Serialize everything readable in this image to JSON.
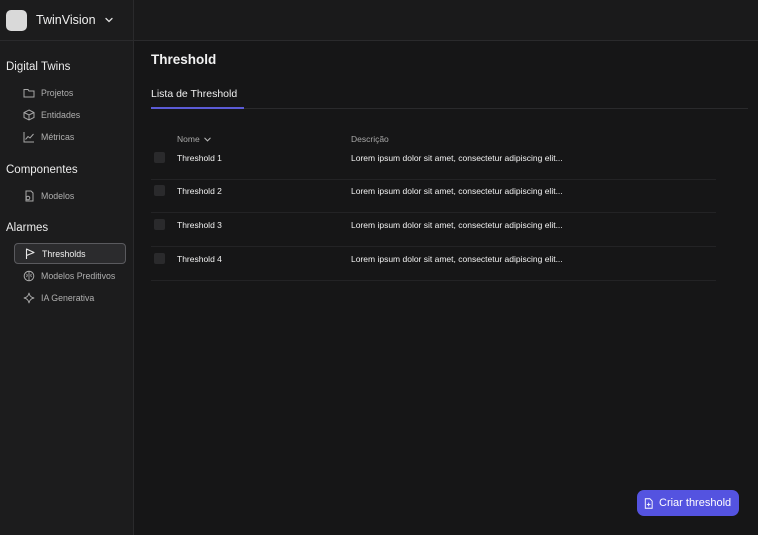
{
  "brand": {
    "name": "TwinVision"
  },
  "sidebar": {
    "sections": [
      {
        "title": "Digital Twins",
        "items": [
          {
            "label": "Projetos",
            "icon": "folder-icon"
          },
          {
            "label": "Entidades",
            "icon": "cube-icon"
          },
          {
            "label": "Métricas",
            "icon": "chart-line-icon"
          }
        ]
      },
      {
        "title": "Componentes",
        "items": [
          {
            "label": "Modelos",
            "icon": "file-model-icon"
          }
        ]
      },
      {
        "title": "Alarmes",
        "items": [
          {
            "label": "Thresholds",
            "icon": "flag-icon",
            "active": true
          },
          {
            "label": "Modelos Preditivos",
            "icon": "brain-icon"
          },
          {
            "label": "IA Generativa",
            "icon": "sparkle-icon"
          }
        ]
      }
    ]
  },
  "main": {
    "title": "Threshold",
    "tab": "Lista de Threshold",
    "table": {
      "columns": [
        "Nome",
        "Descrição"
      ],
      "rows": [
        {
          "name": "Threshold 1",
          "description": "Lorem ipsum dolor sit amet, consectetur adipiscing elit..."
        },
        {
          "name": "Threshold 2",
          "description": "Lorem ipsum dolor sit amet, consectetur adipiscing elit..."
        },
        {
          "name": "Threshold 3",
          "description": "Lorem ipsum dolor sit amet, consectetur adipiscing elit..."
        },
        {
          "name": "Threshold 4",
          "description": "Lorem ipsum dolor sit amet, consectetur adipiscing elit..."
        }
      ]
    },
    "create_button": "Criar threshold"
  },
  "colors": {
    "accent": "#5453e0",
    "background": "#161617",
    "sidebar": "#1c1c1d"
  }
}
